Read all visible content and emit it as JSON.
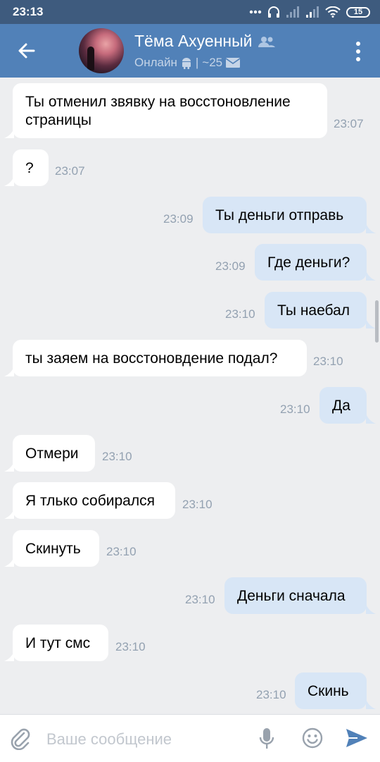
{
  "status_bar": {
    "time": "23:13",
    "battery": "15"
  },
  "header": {
    "name": "Тёма Ахуенный",
    "status": "Онлайн",
    "separator": "|",
    "count": "~25"
  },
  "messages": [
    {
      "dir": "in",
      "lines": [
        "Ты отменил звявку на восстоновление",
        "страницы"
      ],
      "time": "23:07"
    },
    {
      "dir": "in",
      "text": "?",
      "time": "23:07"
    },
    {
      "dir": "out",
      "text": "Ты деньги отправь",
      "time": "23:09"
    },
    {
      "dir": "out",
      "text": "Где деньги?",
      "time": "23:09"
    },
    {
      "dir": "out",
      "text": "Ты наебал",
      "time": "23:10"
    },
    {
      "dir": "in",
      "text": "ты заяем на восстоновдение подал?",
      "time": "23:10"
    },
    {
      "dir": "out",
      "text": "Да",
      "time": "23:10"
    },
    {
      "dir": "in",
      "text": "Отмери",
      "time": "23:10"
    },
    {
      "dir": "in",
      "text": "Я тлько собирался",
      "time": "23:10"
    },
    {
      "dir": "in",
      "text": "Скинуть",
      "time": "23:10"
    },
    {
      "dir": "out",
      "text": "Деньги сначала",
      "time": "23:10"
    },
    {
      "dir": "in",
      "text": "И тут смс",
      "time": "23:10"
    },
    {
      "dir": "out",
      "text": "Скинь",
      "time": "23:10"
    }
  ],
  "composer": {
    "placeholder": "Ваше сообщение"
  },
  "icons": {
    "back": "arrow-left-icon",
    "menu": "more-vertical-icon",
    "attach": "paperclip-icon",
    "mic": "microphone-icon",
    "emoji": "smiley-icon",
    "send": "send-icon",
    "android": "android-icon",
    "mail": "envelope-icon",
    "friends": "friends-icon"
  },
  "colors": {
    "header": "#5181b8",
    "status_bar": "#3e5b7e",
    "incoming_bubble": "#ffffff",
    "outgoing_bubble": "#d8e6f6",
    "background": "#edeef0",
    "accent": "#5181b8"
  }
}
